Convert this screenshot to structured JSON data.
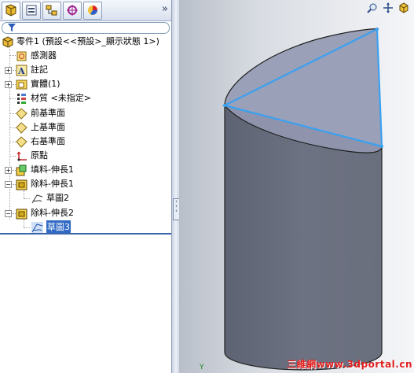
{
  "panel": {
    "tabs": [
      {
        "name": "featuremanager-tab",
        "icon": "feature-tree-icon"
      },
      {
        "name": "propertymanager-tab",
        "icon": "property-manager-icon"
      },
      {
        "name": "configurationmanager-tab",
        "icon": "configuration-manager-icon"
      },
      {
        "name": "dimxpert-tab",
        "icon": "dimxpert-icon"
      },
      {
        "name": "display-manager-tab",
        "icon": "display-manager-icon"
      }
    ],
    "expand_glyph": "»"
  },
  "tree": {
    "root": "零件1  (預設<<預設>_顯示狀態 1>)",
    "items": [
      {
        "label": "感測器",
        "icon": "sensor-icon"
      },
      {
        "label": "註記",
        "icon": "annotations-icon"
      },
      {
        "label": "實體(1)",
        "icon": "solid-bodies-icon"
      },
      {
        "label": "材質 <未指定>",
        "icon": "material-icon"
      },
      {
        "label": "前基準面",
        "icon": "plane-icon"
      },
      {
        "label": "上基準面",
        "icon": "plane-icon"
      },
      {
        "label": "右基準面",
        "icon": "plane-icon"
      },
      {
        "label": "原點",
        "icon": "origin-icon"
      },
      {
        "label": "填料-伸長1",
        "icon": "extrude-boss-icon"
      },
      {
        "label": "除料-伸長1",
        "icon": "extrude-cut-icon"
      },
      {
        "label": "草圖2",
        "icon": "sketch-icon"
      },
      {
        "label": "除料-伸長2",
        "icon": "extrude-cut-icon"
      },
      {
        "label": "草圖3",
        "icon": "sketch-icon"
      }
    ]
  },
  "viewport": {
    "toolbar": [
      "zoom-to-fit-icon",
      "pan-icon",
      "view-orientation-icon"
    ],
    "watermark": "三維網www.3dportal.cn",
    "axis_label": "Y",
    "colors": {
      "body": "#6a6f7e",
      "cut_face": "#9599b0",
      "edge_highlight": "#3aa0f0"
    }
  }
}
